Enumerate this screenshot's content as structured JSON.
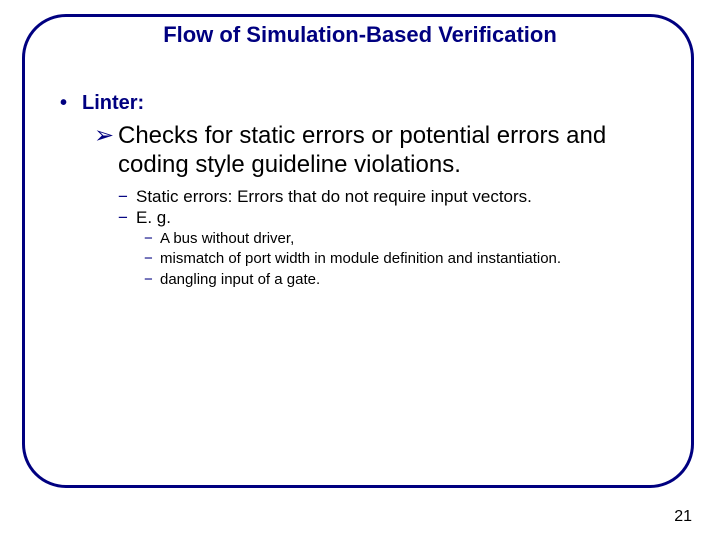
{
  "title": "Flow of Simulation-Based Verification",
  "bullets": {
    "lvl1": {
      "marker": "•",
      "text": "Linter:"
    },
    "lvl2": {
      "marker": "➢",
      "text": "Checks for static errors or potential errors and coding style guideline violations."
    },
    "lvl3a": {
      "marker": "−",
      "text": "Static errors: Errors that do not require input vectors."
    },
    "lvl3b": {
      "marker": "−",
      "text": "E. g."
    },
    "lvl4a": {
      "marker": "−",
      "text": "A bus without driver,"
    },
    "lvl4b": {
      "marker": "−",
      "text": "mismatch of port width in module definition and instantiation."
    },
    "lvl4c": {
      "marker": "−",
      "text": "dangling input of a gate."
    }
  },
  "page_number": "21"
}
